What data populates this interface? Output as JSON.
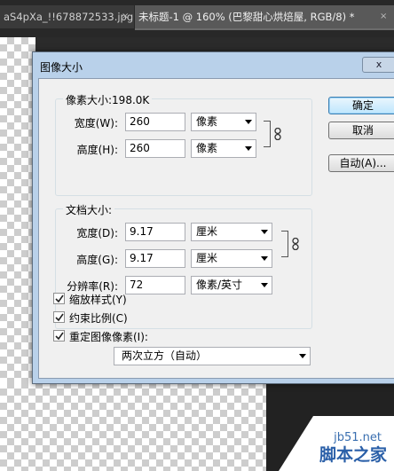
{
  "tabs": [
    {
      "label": "aS4pXa_!!678872533.jpg",
      "close": "×"
    },
    {
      "label": "未标题-1 @ 160% (巴黎甜心烘焙屋, RGB/8) *",
      "close": "×"
    }
  ],
  "dialog": {
    "title": "图像大小",
    "close_glyph": "x",
    "pixel_group": {
      "title": "像素大小:198.0K",
      "width_label": "宽度(W):",
      "width_value": "260",
      "width_unit": "像素",
      "height_label": "高度(H):",
      "height_value": "260",
      "height_unit": "像素"
    },
    "doc_group": {
      "title": "文档大小:",
      "width_label": "宽度(D):",
      "width_value": "9.17",
      "width_unit": "厘米",
      "height_label": "高度(G):",
      "height_value": "9.17",
      "height_unit": "厘米",
      "res_label": "分辨率(R):",
      "res_value": "72",
      "res_unit": "像素/英寸"
    },
    "buttons": {
      "ok": "确定",
      "cancel": "取消",
      "auto": "自动(A)..."
    },
    "checkboxes": [
      {
        "label": "缩放样式(Y)",
        "checked": true
      },
      {
        "label": "约束比例(C)",
        "checked": true
      },
      {
        "label": "重定图像像素(I):",
        "checked": true
      }
    ],
    "resample": "两次立方（自动）"
  },
  "watermark": {
    "url": "jb51.net",
    "name": "脚本之家"
  }
}
